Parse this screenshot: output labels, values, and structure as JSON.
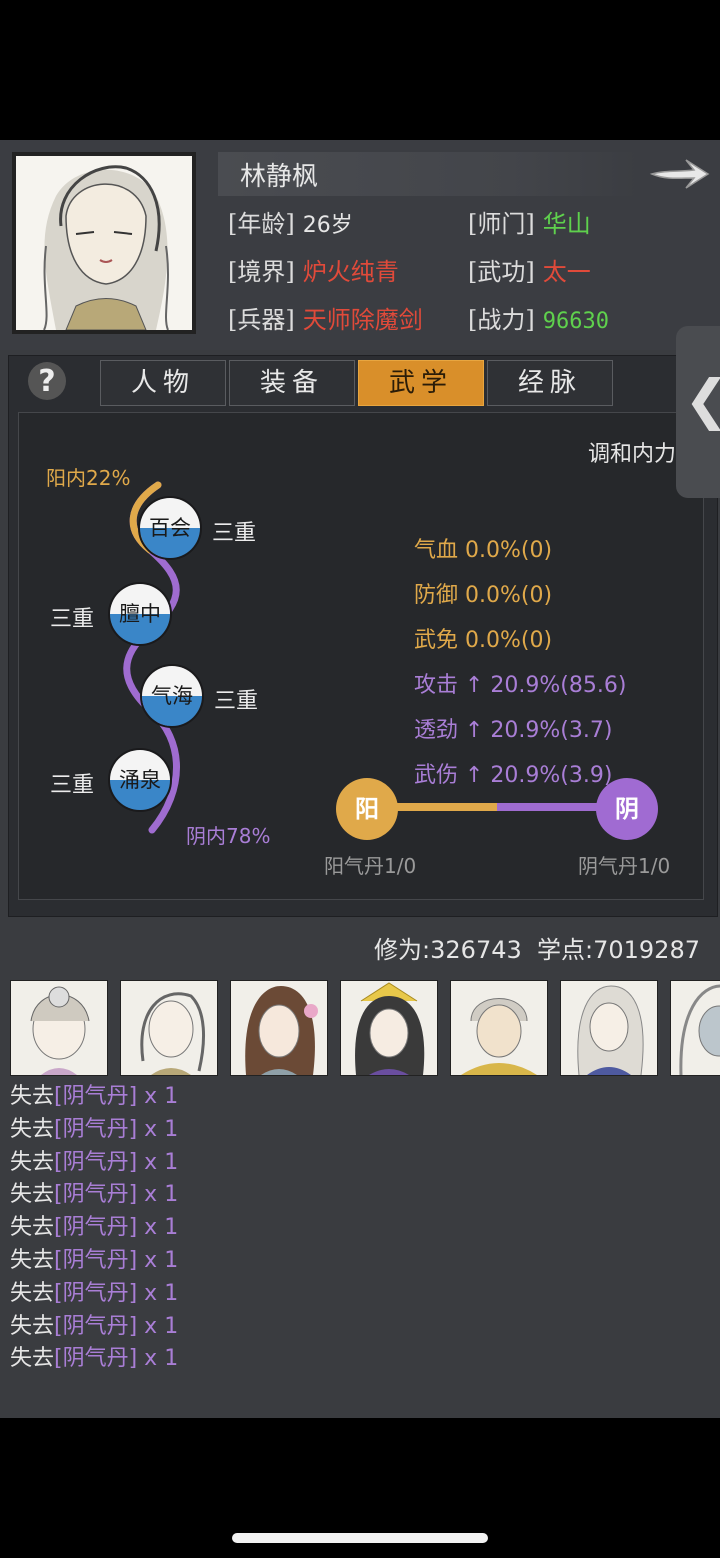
{
  "character": {
    "name": "林静枫",
    "stats": [
      {
        "label": "[年龄]",
        "value": "26岁",
        "color": "#e6e6e6"
      },
      {
        "label": "[师门]",
        "value": "华山",
        "color": "#5fd14d"
      },
      {
        "label": "[境界]",
        "value": "炉火纯青",
        "color": "#e04a3a"
      },
      {
        "label": "[武功]",
        "value": "太一",
        "color": "#e04a3a"
      },
      {
        "label": "[兵器]",
        "value": "天师除魔剑",
        "color": "#e04a3a"
      },
      {
        "label": "[战力]",
        "value": "96630",
        "color": "#5fd14d"
      }
    ]
  },
  "help_label": "?",
  "tabs": [
    "人物",
    "装备",
    "武学",
    "经脉"
  ],
  "active_tab": "武学",
  "side_handle_glyph": "❮",
  "martial": {
    "balance_title": "调和内力",
    "yang_pct": "阳内22%",
    "yin_pct": "阴内78%",
    "nodes": [
      {
        "name": "百会",
        "level": "三重"
      },
      {
        "name": "膻中",
        "level": "三重"
      },
      {
        "name": "气海",
        "level": "三重"
      },
      {
        "name": "涌泉",
        "level": "三重"
      }
    ],
    "effects": [
      {
        "text": "气血 0.0%(0)",
        "tone": "gold"
      },
      {
        "text": "防御 0.0%(0)",
        "tone": "gold"
      },
      {
        "text": "武免 0.0%(0)",
        "tone": "gold"
      },
      {
        "text": "攻击 ↑ 20.9%(85.6)",
        "tone": "purple"
      },
      {
        "text": "透劲 ↑ 20.9%(3.7)",
        "tone": "purple"
      },
      {
        "text": "武伤 ↑ 20.9%(3.9)",
        "tone": "purple"
      }
    ],
    "yang_pill": {
      "glyph": "阳",
      "label": "阳气丹1/0",
      "color": "#e0a94a"
    },
    "yin_pill": {
      "glyph": "阴",
      "label": "阴气丹1/0",
      "color": "#a06bd2"
    },
    "balance_ratio": 0.5
  },
  "cultivation": "修为:326743",
  "study_points": "学点:7019287",
  "log": [
    {
      "prefix": "失去",
      "item": "[阴气丹]",
      "suffix": " x 1"
    },
    {
      "prefix": "失去",
      "item": "[阴气丹]",
      "suffix": " x 1"
    },
    {
      "prefix": "失去",
      "item": "[阴气丹]",
      "suffix": " x 1"
    },
    {
      "prefix": "失去",
      "item": "[阴气丹]",
      "suffix": " x 1"
    },
    {
      "prefix": "失去",
      "item": "[阴气丹]",
      "suffix": " x 1"
    },
    {
      "prefix": "失去",
      "item": "[阴气丹]",
      "suffix": " x 1"
    },
    {
      "prefix": "失去",
      "item": "[阴气丹]",
      "suffix": " x 1"
    },
    {
      "prefix": "失去",
      "item": "[阴气丹]",
      "suffix": " x 1"
    },
    {
      "prefix": "失去",
      "item": "[阴气丹]",
      "suffix": " x 1"
    }
  ]
}
